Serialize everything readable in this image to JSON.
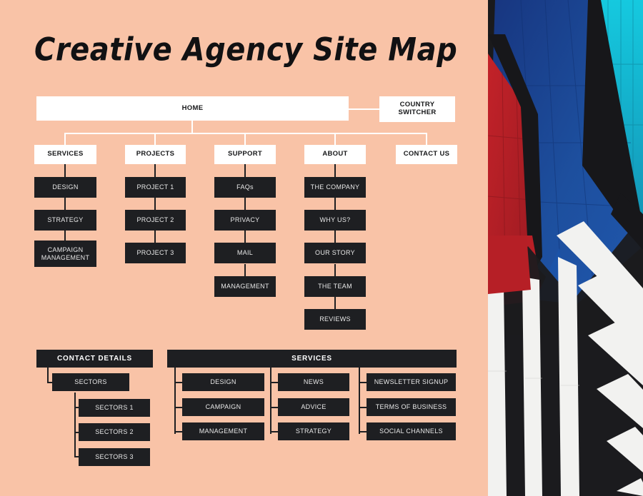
{
  "page": {
    "title": "Creative Agency Site Map",
    "background_color": "#f9c3a7",
    "node_light_color": "#ffffff",
    "node_dark_color": "#1e1f22"
  },
  "sitemap": {
    "root": {
      "label": "HOME"
    },
    "country_switcher": {
      "line1": "COUNTRY",
      "line2": "SWITCHER"
    },
    "top_level": [
      {
        "label": "SERVICES",
        "children": [
          {
            "label": "DESIGN"
          },
          {
            "label": "STRATEGY"
          },
          {
            "line1": "CAMPAIGN",
            "line2": "MANAGEMENT"
          }
        ]
      },
      {
        "label": "PROJECTS",
        "children": [
          {
            "label": "PROJECT 1"
          },
          {
            "label": "PROJECT 2"
          },
          {
            "label": "PROJECT 3"
          }
        ]
      },
      {
        "label": "SUPPORT",
        "children": [
          {
            "label": "FAQs"
          },
          {
            "label": "PRIVACY"
          },
          {
            "label": "MAIL"
          },
          {
            "label": "MANAGEMENT"
          }
        ]
      },
      {
        "label": "ABOUT",
        "children": [
          {
            "label": "THE COMPANY"
          },
          {
            "label": "WHY US?"
          },
          {
            "label": "OUR STORY"
          },
          {
            "label": "THE TEAM"
          },
          {
            "label": "REVIEWS"
          }
        ]
      },
      {
        "label": "CONTACT US",
        "children": []
      }
    ]
  },
  "contact_details": {
    "header": "CONTACT DETAILS",
    "sectors_parent": "SECTORS",
    "sectors": [
      "SECTORS 1",
      "SECTORS 2",
      "SECTORS 3"
    ]
  },
  "services_block": {
    "header": "SERVICES",
    "columns": [
      {
        "items": [
          "DESIGN",
          "CAMPAIGN",
          "MANAGEMENT"
        ]
      },
      {
        "items": [
          "NEWS",
          "ADVICE",
          "STRATEGY"
        ]
      },
      {
        "items": [
          "NEWSLETTER SIGNUP",
          "TERMS OF BUSINESS",
          "SOCIAL CHANNELS"
        ]
      }
    ]
  },
  "photo": {
    "description": "painted-building-facade",
    "colors": {
      "red": "#c0262b",
      "blue": "#1d4f9e",
      "deep_blue": "#17357f",
      "cyan": "#19c8d8",
      "black": "#1a1a1c",
      "white": "#f4f4f2"
    }
  }
}
